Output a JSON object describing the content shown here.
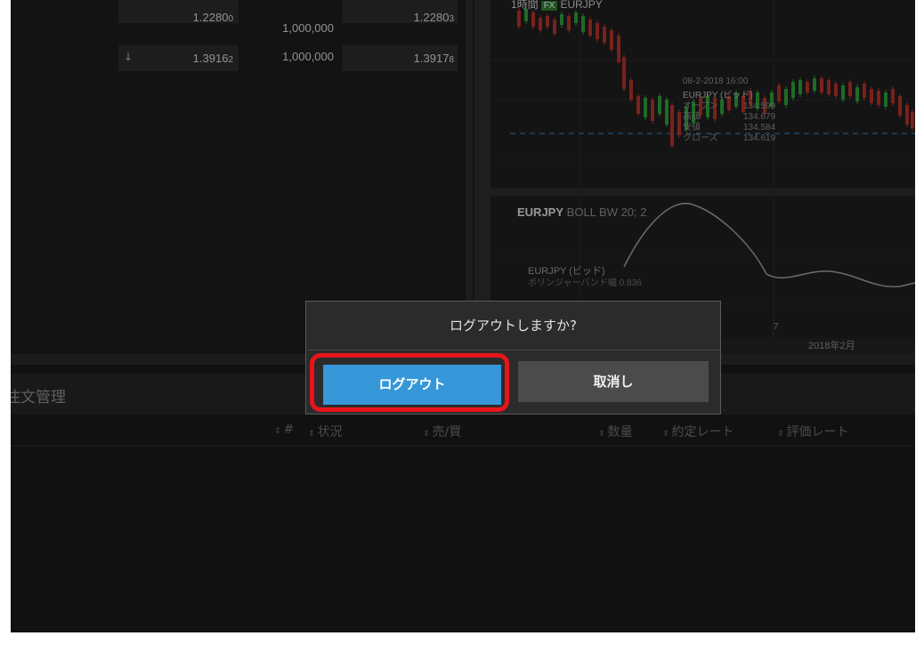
{
  "quotes": {
    "rows": [
      {
        "bid_main": "1.2280",
        "bid_sub": "0",
        "amount": "1,000,000",
        "ask_main": "1.2280",
        "ask_sub": "3",
        "arrow": ""
      },
      {
        "bid_main": "1.3916",
        "bid_sub": "2",
        "amount": "1,000,000",
        "ask_main": "1.3917",
        "ask_sub": "8",
        "arrow": "↓"
      }
    ]
  },
  "chart": {
    "timeframe": "1時間",
    "badge": "FX",
    "symbol": "EURJPY",
    "tooltip": {
      "datetime": "08-2-2018 16:00",
      "symbol": "EURJPY (ビッド)",
      "rows": [
        {
          "label": "オープン",
          "value": "134.599"
        },
        {
          "label": "高値",
          "value": "134.679"
        },
        {
          "label": "安値",
          "value": "134.584"
        },
        {
          "label": "クローズ",
          "value": "134.619"
        }
      ]
    },
    "indicator": {
      "symbol": "EURJPY",
      "name": "BOLL BW 20; 2",
      "legend_symbol": "EURJPY (ビッド)",
      "legend_value": "ボリンジャーバンド幅 0.836"
    },
    "x_tick": "7",
    "x_label": "2018年2月",
    "colors": {
      "up": "#2e9d3a",
      "down": "#b3312c",
      "dashed": "#3f8fd0"
    }
  },
  "orders": {
    "title": "注文管理",
    "columns": [
      "#",
      "状況",
      "売/買",
      "数量",
      "約定レート",
      "評価レート"
    ]
  },
  "dialog": {
    "message": "ログアウトしますか?",
    "logout_label": "ログアウト",
    "cancel_label": "取消し",
    "highlight_color": "#e8141b",
    "primary_color": "#3597d8"
  }
}
